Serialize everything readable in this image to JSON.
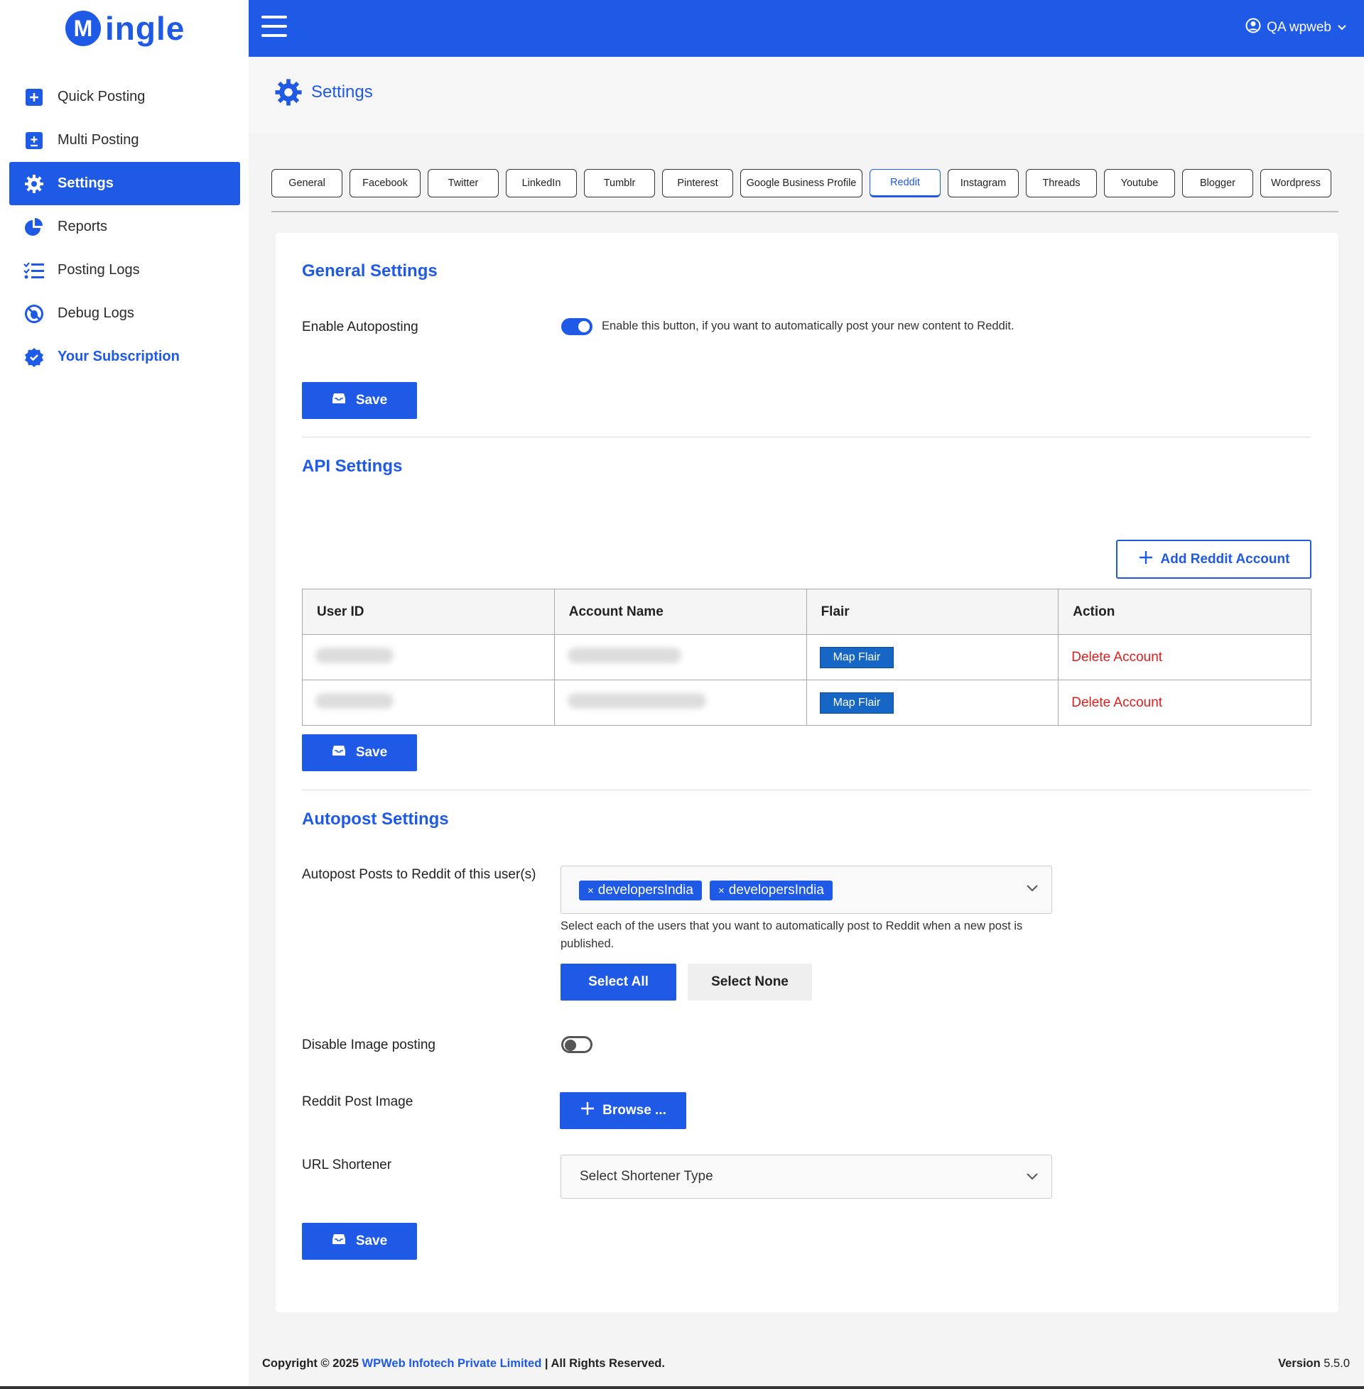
{
  "app": {
    "logo_mark": "M",
    "logo_text": "ingle",
    "brand_color": "#1f5ae6"
  },
  "sidebar": {
    "items": [
      {
        "label": "Quick Posting",
        "icon": "plus-square-icon"
      },
      {
        "label": "Multi Posting",
        "icon": "plus-square-icon"
      },
      {
        "label": "Settings",
        "icon": "gear-icon",
        "active": true
      },
      {
        "label": "Reports",
        "icon": "pie-chart-icon"
      },
      {
        "label": "Posting Logs",
        "icon": "list-check-icon"
      },
      {
        "label": "Debug Logs",
        "icon": "bug-slash-icon"
      },
      {
        "label": "Your Subscription",
        "icon": "badge-check-icon"
      }
    ]
  },
  "topbar": {
    "user_name": "QA wpweb"
  },
  "page": {
    "title": "Settings"
  },
  "tabs": [
    "General",
    "Facebook",
    "Twitter",
    "LinkedIn",
    "Tumblr",
    "Pinterest",
    "Google Business Profile",
    "Reddit",
    "Instagram",
    "Threads",
    "Youtube",
    "Blogger",
    "Wordpress"
  ],
  "active_tab": "Reddit",
  "general": {
    "title": "General Settings",
    "autopost_label": "Enable Autoposting",
    "autopost_enabled": true,
    "autopost_help": "Enable this button, if you want to automatically post your new content to Reddit.",
    "save_label": "Save"
  },
  "api": {
    "title": "API Settings",
    "add_label": "Add Reddit Account",
    "columns": [
      "User ID",
      "Account Name",
      "Flair",
      "Action"
    ],
    "rows": [
      {
        "flair_label": "Map Flair",
        "action_label": "Delete Account"
      },
      {
        "flair_label": "Map Flair",
        "action_label": "Delete Account"
      }
    ],
    "save_label": "Save"
  },
  "autopost": {
    "title": "Autopost Settings",
    "users_label": "Autopost Posts to Reddit of this user(s)",
    "selected_users": [
      "developersIndia",
      "developersIndia"
    ],
    "users_help_line1": "Select each of the users that you want to automatically post to Reddit when a new post is",
    "users_help_line2": "published.",
    "select_all_label": "Select All",
    "select_none_label": "Select None",
    "disable_image_label": "Disable Image posting",
    "disable_image_enabled": false,
    "post_image_label": "Reddit Post Image",
    "browse_label": "Browse ...",
    "shortener_label": "URL Shortener",
    "shortener_placeholder": "Select Shortener Type",
    "save_label": "Save"
  },
  "footer": {
    "copyright_prefix": "Copyright © 2025",
    "company": "WPWeb Infotech Private Limited",
    "copyright_suffix": "| All Rights Reserved.",
    "version_label": "Version",
    "version": "5.5.0"
  }
}
